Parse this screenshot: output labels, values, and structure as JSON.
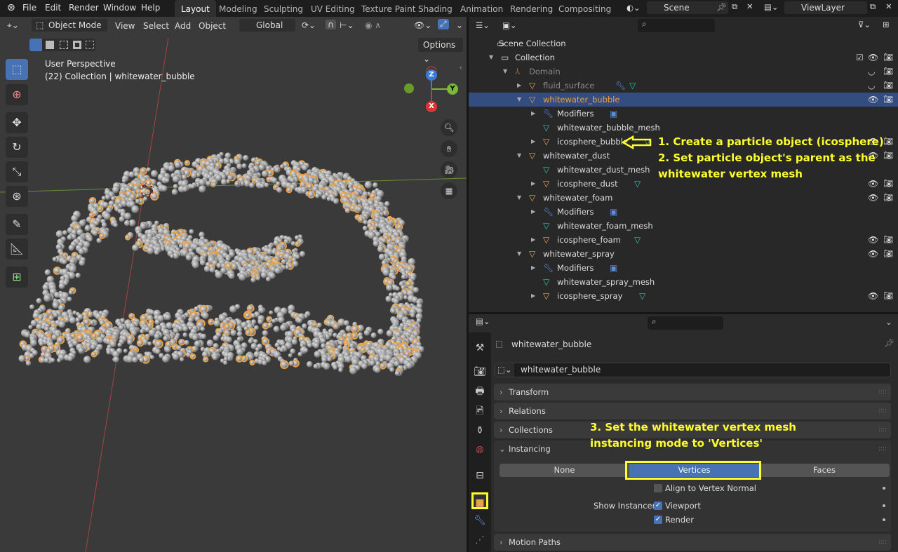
{
  "topbar": {
    "menus": [
      "File",
      "Edit",
      "Render",
      "Window",
      "Help"
    ],
    "workspaces": [
      "Layout",
      "Modeling",
      "Sculpting",
      "UV Editing",
      "Texture Paint",
      "Shading",
      "Animation",
      "Rendering",
      "Compositing"
    ],
    "active_workspace": "Layout",
    "scene": "Scene",
    "view_layer": "ViewLayer"
  },
  "viewport": {
    "mode": "Object Mode",
    "menus": [
      "View",
      "Select",
      "Add",
      "Object"
    ],
    "orientation": "Global",
    "options": "Options",
    "overlay_title": "User Perspective",
    "overlay_subtitle": "(22) Collection | whitewater_bubble",
    "gizmo": {
      "z": "Z",
      "y": "Y",
      "x": "X"
    }
  },
  "outliner": {
    "rows": [
      {
        "label": "Scene Collection",
        "depth": 0,
        "icon": "scene-collection",
        "arrow": "",
        "vis": false
      },
      {
        "label": "Collection",
        "depth": 1,
        "icon": "collection",
        "arrow": "down",
        "vis": true,
        "check": true
      },
      {
        "label": "Domain",
        "depth": 2,
        "icon": "empty",
        "arrow": "down",
        "vis": "hidden",
        "dim": true
      },
      {
        "label": "fluid_surface",
        "depth": 3,
        "icon": "mesh-object",
        "arrow": "right",
        "vis": "hidden",
        "dim": true,
        "extra": [
          "wrench",
          "mesh"
        ]
      },
      {
        "label": "whitewater_bubble",
        "depth": 3,
        "icon": "mesh-object",
        "arrow": "down",
        "vis": true,
        "selected": true
      },
      {
        "label": "Modifiers",
        "depth": 4,
        "icon": "wrench",
        "arrow": "right",
        "vis": false,
        "extra": [
          "modifier"
        ]
      },
      {
        "label": "whitewater_bubble_mesh",
        "depth": 4,
        "icon": "mesh",
        "arrow": "",
        "vis": false
      },
      {
        "label": "icosphere_bubble",
        "depth": 4,
        "icon": "mesh-object",
        "arrow": "right",
        "vis": true,
        "extra": [
          "mesh"
        ]
      },
      {
        "label": "whitewater_dust",
        "depth": 3,
        "icon": "mesh-object",
        "arrow": "down",
        "vis": true
      },
      {
        "label": "whitewater_dust_mesh",
        "depth": 4,
        "icon": "mesh",
        "arrow": "",
        "vis": false
      },
      {
        "label": "icosphere_dust",
        "depth": 4,
        "icon": "mesh-object",
        "arrow": "right",
        "vis": true,
        "extra": [
          "mesh"
        ]
      },
      {
        "label": "whitewater_foam",
        "depth": 3,
        "icon": "mesh-object",
        "arrow": "down",
        "vis": true
      },
      {
        "label": "Modifiers",
        "depth": 4,
        "icon": "wrench",
        "arrow": "right",
        "vis": false,
        "extra": [
          "modifier"
        ]
      },
      {
        "label": "whitewater_foam_mesh",
        "depth": 4,
        "icon": "mesh",
        "arrow": "",
        "vis": false
      },
      {
        "label": "icosphere_foam",
        "depth": 4,
        "icon": "mesh-object",
        "arrow": "right",
        "vis": true,
        "extra": [
          "mesh"
        ]
      },
      {
        "label": "whitewater_spray",
        "depth": 3,
        "icon": "mesh-object",
        "arrow": "down",
        "vis": true
      },
      {
        "label": "Modifiers",
        "depth": 4,
        "icon": "wrench",
        "arrow": "right",
        "vis": false,
        "extra": [
          "modifier"
        ]
      },
      {
        "label": "whitewater_spray_mesh",
        "depth": 4,
        "icon": "mesh",
        "arrow": "",
        "vis": false
      },
      {
        "label": "icosphere_spray",
        "depth": 4,
        "icon": "mesh-object",
        "arrow": "right",
        "vis": true,
        "extra": [
          "mesh"
        ]
      }
    ]
  },
  "annotations": {
    "step1": "1. Create a particle object (icosphere)",
    "step2a": "2. Set particle object's parent as the",
    "step2b": "whitewater vertex mesh",
    "step3a": "3. Set the whitewater vertex mesh",
    "step3b": "instancing mode to 'Vertices'",
    "color": "#ffff2e"
  },
  "properties": {
    "object_name": "whitewater_bubble",
    "datablock": "whitewater_bubble",
    "panels": [
      "Transform",
      "Relations",
      "Collections",
      "Instancing",
      "Motion Paths"
    ],
    "instancing": {
      "options": [
        "None",
        "Vertices",
        "Faces"
      ],
      "selected": "Vertices",
      "align_label": "Align to Vertex Normal",
      "align": false,
      "show_instancer_label": "Show Instancer",
      "viewport_label": "Viewport",
      "viewport": true,
      "render_label": "Render",
      "render": true
    },
    "active_tab": "object"
  },
  "colors": {
    "accent": "#4772b3",
    "selection": "#334d80",
    "object_orange": "#e8a24a",
    "highlight": "#ffff2e"
  }
}
